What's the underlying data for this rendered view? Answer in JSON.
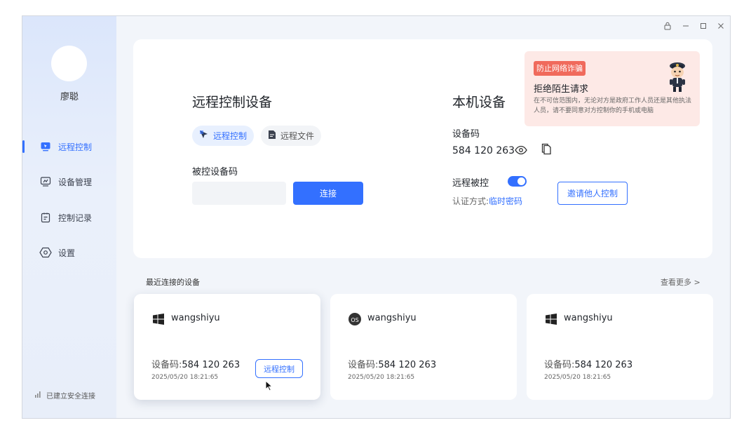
{
  "sidebar": {
    "username": "廖聪",
    "items": [
      {
        "label": "远程控制",
        "icon": "remote-control-icon",
        "active": true
      },
      {
        "label": "设备管理",
        "icon": "monitor-icon",
        "active": false
      },
      {
        "label": "控制记录",
        "icon": "clipboard-icon",
        "active": false
      },
      {
        "label": "设置",
        "icon": "gear-icon",
        "active": false
      }
    ],
    "status": "已建立安全连接"
  },
  "remote": {
    "title": "远程控制设备",
    "tabs": [
      {
        "label": "远程控制",
        "icon": "cursor-arrow-icon",
        "active": true
      },
      {
        "label": "远程文件",
        "icon": "file-icon",
        "active": false
      }
    ],
    "code_label": "被控设备码",
    "input_value": "",
    "connect_label": "连接"
  },
  "local": {
    "title": "本机设备",
    "code_label": "设备码",
    "code": "584 120 263",
    "controlled_label": "远程被控",
    "controlled_enabled": true,
    "auth_label": "认证方式:",
    "auth_value": "临时密码",
    "invite_label": "邀请他人控制"
  },
  "warning": {
    "tag": "防止网络诈骗",
    "title": "拒绝陌生请求",
    "text": "在不可信范围内，无论对方是政府工作人员还是其他执法人员，请不要同意对方控制你的手机或电脑"
  },
  "recent": {
    "title": "最近连接的设备",
    "more": "查看更多 >",
    "code_label": "设备码:",
    "devices": [
      {
        "name": "wangshiyu",
        "os": "windows",
        "code": "584 120 263",
        "time": "2025/05/20 18:21:65",
        "button": "远程控制"
      },
      {
        "name": "wangshiyu",
        "os": "macos",
        "code": "584 120 263",
        "time": "2025/05/20 18:21:65"
      },
      {
        "name": "wangshiyu",
        "os": "windows",
        "code": "584 120 263",
        "time": "2025/05/20 18:21:65"
      }
    ]
  },
  "colors": {
    "accent": "#3370ff",
    "warning_tag": "#f06a5c",
    "warning_bg": "#fde9e6"
  }
}
